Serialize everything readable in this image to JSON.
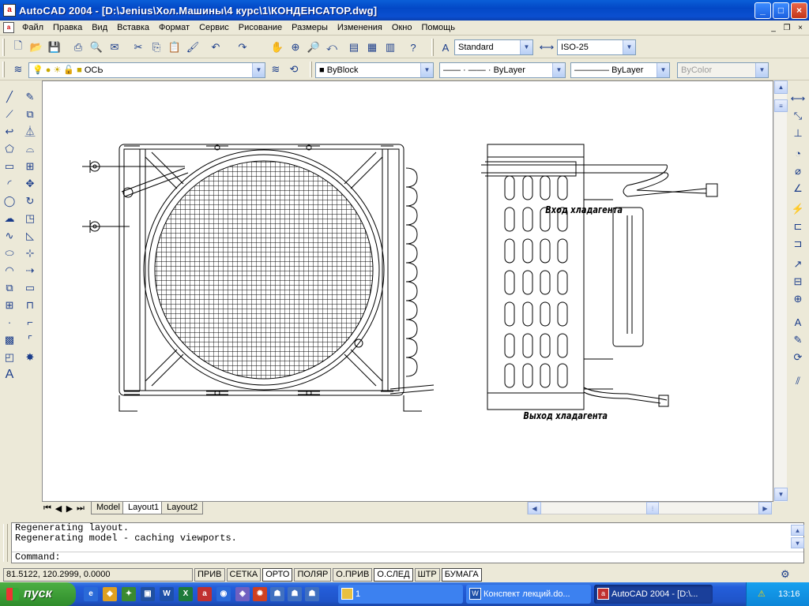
{
  "window": {
    "title": "AutoCAD 2004 - [D:\\Jenius\\Хол.Машины\\4 курс\\1\\КОНДЕНСАТОР.dwg]",
    "controls": {
      "minimize": "_",
      "maximize": "□",
      "close": "×"
    }
  },
  "menu": {
    "items": [
      "Файл",
      "Правка",
      "Вид",
      "Вставка",
      "Формат",
      "Сервис",
      "Рисование",
      "Размеры",
      "Изменения",
      "Окно",
      "Помощь"
    ],
    "doc_controls": {
      "minimize": "_",
      "restore": "❐",
      "close": "×"
    }
  },
  "toolbar": {
    "text_style": "Standard",
    "dim_style": "ISO-25"
  },
  "layers": {
    "current_layer": "ОСЬ",
    "color": "ByBlock",
    "linetype": "ByLayer",
    "lineweight": "ByLayer",
    "plotstyle": "ByColor"
  },
  "drawing": {
    "label_inlet": "Вход хладагента",
    "label_outlet": "Выход хладагента"
  },
  "layout_tabs": {
    "nav": [
      "⏮",
      "◀",
      "▶",
      "⏭"
    ],
    "tabs": [
      "Model",
      "Layout1",
      "Layout2"
    ],
    "active": "Layout1"
  },
  "command": {
    "history": [
      "Regenerating layout.",
      "Regenerating model - caching viewports."
    ],
    "prompt": "Command:"
  },
  "status": {
    "coords": "81.5122, 120.2999, 0.0000",
    "modes": [
      "ПРИВ",
      "СЕТКА",
      "ОРТО",
      "ПОЛЯР",
      "О.ПРИВ",
      "О.СЛЕД",
      "ШТР",
      "БУМАГА"
    ],
    "active_modes": [
      "ОРТО",
      "О.СЛЕД",
      "БУМАГА"
    ]
  },
  "taskbar": {
    "start_label": "пуск",
    "tasks": [
      {
        "label": "1",
        "icon": "folder-icon"
      },
      {
        "label": "Конспект лекций.do...",
        "icon": "word-icon"
      },
      {
        "label": "AutoCAD 2004 - [D:\\...",
        "icon": "autocad-icon"
      }
    ],
    "clock": "13:16"
  },
  "colors": {
    "title_blue": "#0a5fd8",
    "taskbar_blue": "#245edb",
    "start_green": "#3c9a36"
  }
}
